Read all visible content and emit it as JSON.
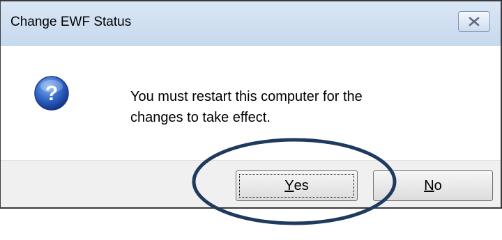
{
  "dialog": {
    "title": "Change EWF Status",
    "close_icon": "close-icon",
    "icon": "question-icon",
    "message_line1": "You must restart this computer for the",
    "message_line2": "changes to take effect."
  },
  "buttons": {
    "yes": {
      "mnemonic": "Y",
      "rest": "es"
    },
    "no": {
      "mnemonic": "N",
      "rest": "o"
    }
  },
  "annotation": {
    "shape": "ellipse-highlight",
    "color": "#1f3a5f"
  }
}
